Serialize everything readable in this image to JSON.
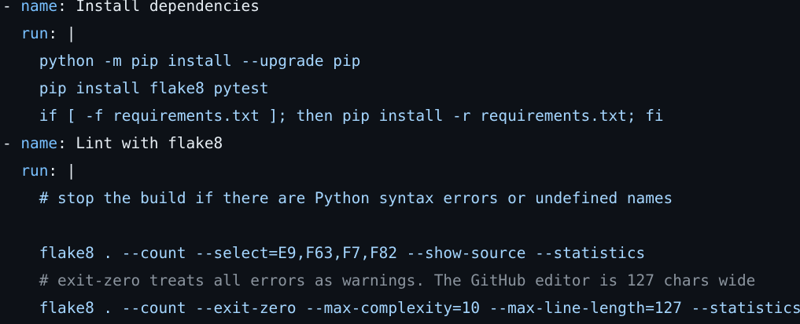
{
  "colors": {
    "background": "#0d1117",
    "key": "#79c0ff",
    "text": "#e6edf3",
    "string": "#a5d6ff",
    "comment_dim": "#8b949e"
  },
  "code": {
    "lines": [
      {
        "dash": "- ",
        "key": "name",
        "colon": ": ",
        "value": "Install dependencies"
      },
      {
        "indent": "  ",
        "key": "run",
        "colon": ": ",
        "value": "|"
      },
      {
        "indent": "    ",
        "text": "python -m pip install --upgrade pip"
      },
      {
        "indent": "    ",
        "text": "pip install flake8 pytest"
      },
      {
        "indent": "    ",
        "text": "if [ -f requirements.txt ]; then pip install -r requirements.txt; fi"
      },
      {
        "dash": "- ",
        "key": "name",
        "colon": ": ",
        "value": "Lint with flake8"
      },
      {
        "indent": "  ",
        "key": "run",
        "colon": ": ",
        "value": "|"
      },
      {
        "indent": "    ",
        "text": "# stop the build if there are Python syntax errors or undefined names"
      },
      {
        "indent": "",
        "text": ""
      },
      {
        "indent": "    ",
        "text": "flake8 . --count --select=E9,F63,F7,F82 --show-source --statistics"
      },
      {
        "indent": "    ",
        "text": "# exit-zero treats all errors as warnings. The GitHub editor is 127 chars wide"
      },
      {
        "indent": "    ",
        "text": "flake8 . --count --exit-zero --max-complexity=10 --max-line-length=127 --statistics"
      }
    ]
  }
}
